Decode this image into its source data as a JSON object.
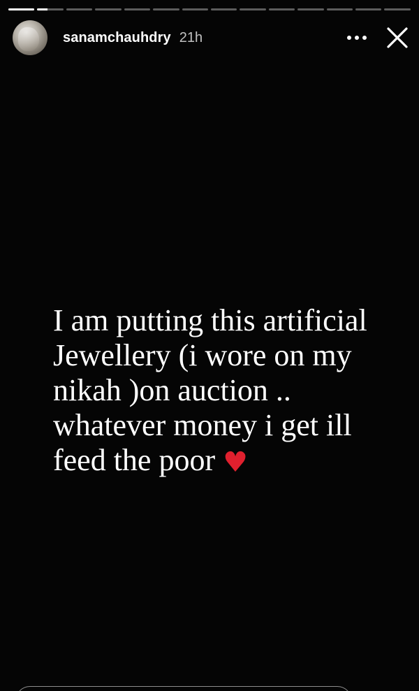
{
  "story": {
    "progress_segments": [
      {
        "progress": 1.0
      },
      {
        "progress": 0.4
      },
      {
        "progress": 0
      },
      {
        "progress": 0
      },
      {
        "progress": 0
      },
      {
        "progress": 0
      },
      {
        "progress": 0
      },
      {
        "progress": 0
      },
      {
        "progress": 0
      },
      {
        "progress": 0
      },
      {
        "progress": 0
      },
      {
        "progress": 0
      },
      {
        "progress": 0
      },
      {
        "progress": 0
      }
    ],
    "username": "sanamchauhdry",
    "timestamp": "21h",
    "more_icon": "more-horizontal-icon",
    "close_icon": "close-icon",
    "caption": "I am putting this artificial\nJewellery (i wore on my\nnikah )on auction ..\nwhatever money i get ill\nfeed the poor ",
    "caption_emoji": "♥",
    "colors": {
      "background": "#050505",
      "text": "#ffffff",
      "heart": "#e0202e"
    }
  }
}
